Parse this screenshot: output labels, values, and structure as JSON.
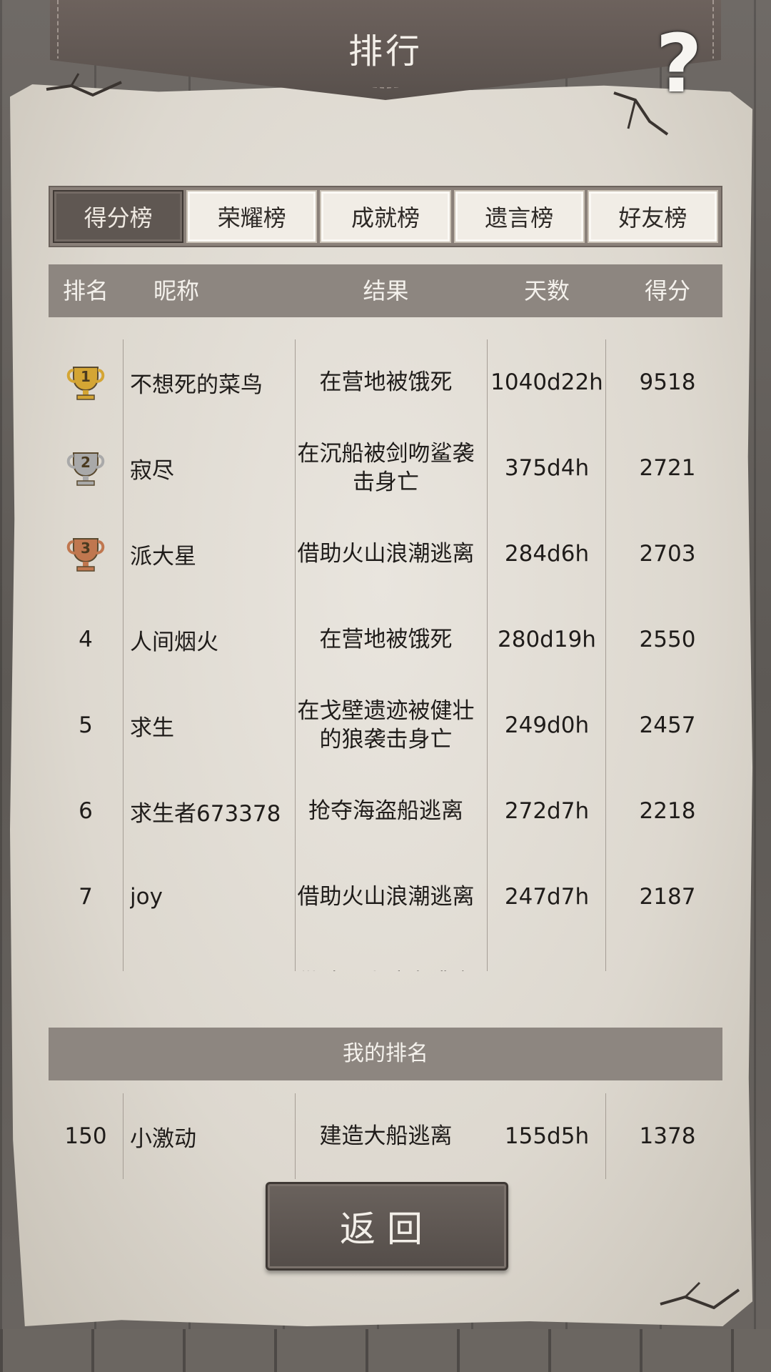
{
  "header": {
    "title": "排行",
    "help_label": "?"
  },
  "tabs": [
    {
      "label": "得分榜",
      "active": true
    },
    {
      "label": "荣耀榜",
      "active": false
    },
    {
      "label": "成就榜",
      "active": false
    },
    {
      "label": "遗言榜",
      "active": false
    },
    {
      "label": "好友榜",
      "active": false
    }
  ],
  "columns": {
    "rank": "排名",
    "name": "昵称",
    "result": "结果",
    "days": "天数",
    "score": "得分"
  },
  "rows": [
    {
      "rank": "1",
      "trophy": "gold",
      "name": "不想死的菜鸟",
      "result": "在营地被饿死",
      "days": "1040d22h",
      "score": "9518"
    },
    {
      "rank": "2",
      "trophy": "silver",
      "name": "寂尽",
      "result": "在沉船被剑吻鲨袭击身亡",
      "days": "375d4h",
      "score": "2721"
    },
    {
      "rank": "3",
      "trophy": "bronze",
      "name": "派大星",
      "result": "借助火山浪潮逃离",
      "days": "284d6h",
      "score": "2703"
    },
    {
      "rank": "4",
      "trophy": "",
      "name": "人间烟火",
      "result": "在营地被饿死",
      "days": "280d19h",
      "score": "2550"
    },
    {
      "rank": "5",
      "trophy": "",
      "name": "求生",
      "result": "在戈壁遗迹被健壮的狼袭击身亡",
      "days": "249d0h",
      "score": "2457"
    },
    {
      "rank": "6",
      "trophy": "",
      "name": "求生者673378",
      "result": "抢夺海盗船逃离",
      "days": "272d7h",
      "score": "2218"
    },
    {
      "rank": "7",
      "trophy": "",
      "name": "joy",
      "result": "借助火山浪潮逃离",
      "days": "247d7h",
      "score": "2187"
    },
    {
      "rank": "",
      "trophy": "",
      "name": "",
      "result": "借助火山浪潮逃离",
      "days": "",
      "score": ""
    }
  ],
  "my_rank": {
    "title": "我的排名",
    "rank": "150",
    "name": "小激动",
    "result": "建造大船逃离",
    "days": "155d5h",
    "score": "1378"
  },
  "back_button": {
    "label": "返回"
  },
  "colors": {
    "gold": "#d4a534",
    "silver": "#a9a9a9",
    "bronze": "#c0774f",
    "accent": "#5f5752"
  }
}
